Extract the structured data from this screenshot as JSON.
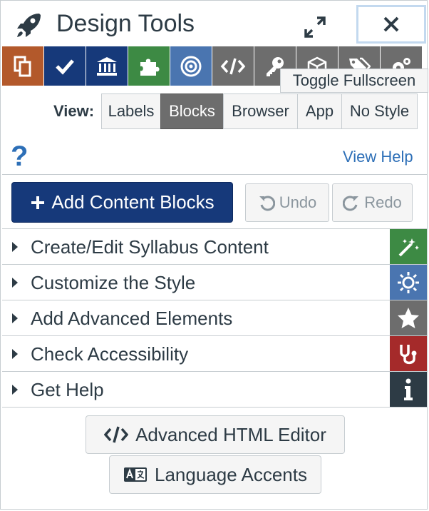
{
  "header": {
    "title": "Design Tools"
  },
  "toolbar": {
    "tools": [
      {
        "icon": "copy-icon",
        "color": "#b3592b"
      },
      {
        "icon": "check-icon",
        "color": "#16397a"
      },
      {
        "icon": "bank-icon",
        "color": "#16397a"
      },
      {
        "icon": "puzzle-icon",
        "color": "#3d8a44"
      },
      {
        "icon": "bullseye-icon",
        "color": "#4a75b0"
      },
      {
        "icon": "code-icon",
        "color": "#6d6d6d"
      },
      {
        "icon": "key-icon",
        "color": "#6d6d6d"
      },
      {
        "icon": "cube-icon",
        "color": "#6d6d6d"
      },
      {
        "icon": "tags-icon",
        "color": "#6d6d6d"
      },
      {
        "icon": "cogs-icon",
        "color": "#6d6d6d"
      }
    ],
    "tooltip": "Toggle Fullscreen"
  },
  "view": {
    "label": "View:",
    "options": [
      "Labels",
      "Blocks",
      "Browser",
      "App",
      "No Style"
    ],
    "selected": "Blocks"
  },
  "help": {
    "link": "View Help"
  },
  "actions": {
    "add": "Add Content Blocks",
    "undo": "Undo",
    "redo": "Redo"
  },
  "sections": [
    {
      "label": "Create/Edit Syllabus Content",
      "color": "#3d8a44",
      "icon": "magic-wand-icon"
    },
    {
      "label": "Customize the Style",
      "color": "#4a75b0",
      "icon": "sun-icon"
    },
    {
      "label": "Add Advanced Elements",
      "color": "#6d6d6d",
      "icon": "star-icon"
    },
    {
      "label": "Check Accessibility",
      "color": "#a52a2a",
      "icon": "stethoscope-icon"
    },
    {
      "label": "Get Help",
      "color": "#2d3b45",
      "icon": "info-icon"
    }
  ],
  "bottom": {
    "advanced_html": "Advanced HTML Editor",
    "language_accents": "Language Accents"
  }
}
